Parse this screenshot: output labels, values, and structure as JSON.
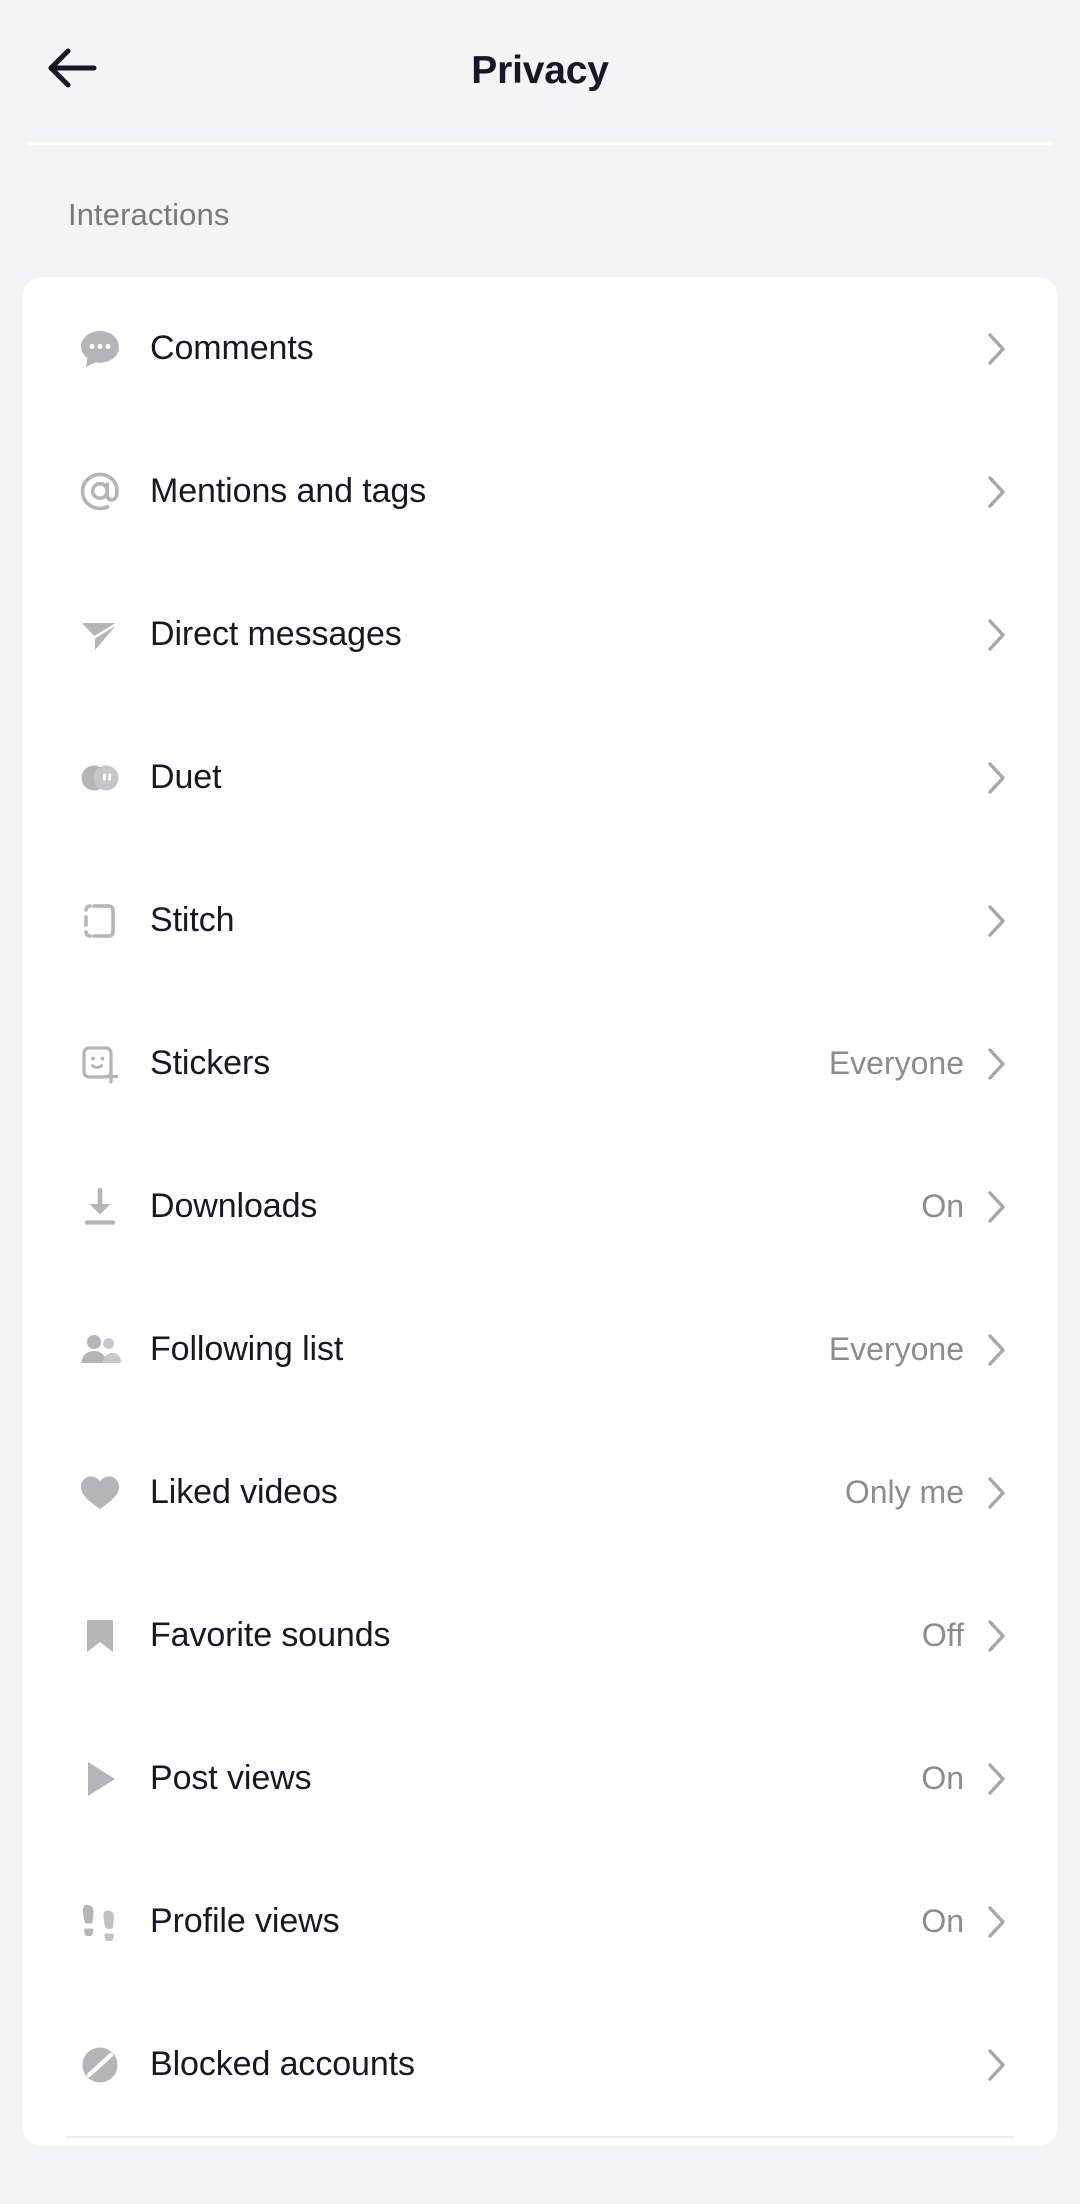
{
  "header": {
    "title": "Privacy",
    "back_icon": "arrow-left-icon"
  },
  "sections": [
    {
      "label": "Interactions",
      "items": [
        {
          "icon": "comment-bubble-icon",
          "label": "Comments",
          "value": "",
          "chevron": "chevron-right-icon"
        },
        {
          "icon": "at-sign-icon",
          "label": "Mentions and tags",
          "value": "",
          "chevron": "chevron-right-icon"
        },
        {
          "icon": "paper-plane-icon",
          "label": "Direct messages",
          "value": "",
          "chevron": "chevron-right-icon"
        },
        {
          "icon": "duet-circles-icon",
          "label": "Duet",
          "value": "",
          "chevron": "chevron-right-icon"
        },
        {
          "icon": "stitch-frame-icon",
          "label": "Stitch",
          "value": "",
          "chevron": "chevron-right-icon"
        },
        {
          "icon": "sticker-smiley-icon",
          "label": "Stickers",
          "value": "Everyone",
          "chevron": "chevron-right-icon"
        },
        {
          "icon": "download-icon",
          "label": "Downloads",
          "value": "On",
          "chevron": "chevron-right-icon"
        },
        {
          "icon": "people-icon",
          "label": "Following list",
          "value": "Everyone",
          "chevron": "chevron-right-icon"
        },
        {
          "icon": "heart-icon",
          "label": "Liked videos",
          "value": "Only me",
          "chevron": "chevron-right-icon"
        },
        {
          "icon": "bookmark-icon",
          "label": "Favorite sounds",
          "value": "Off",
          "chevron": "chevron-right-icon"
        },
        {
          "icon": "play-triangle-icon",
          "label": "Post views",
          "value": "On",
          "chevron": "chevron-right-icon"
        },
        {
          "icon": "footprints-icon",
          "label": "Profile views",
          "value": "On",
          "chevron": "chevron-right-icon"
        },
        {
          "icon": "block-slash-icon",
          "label": "Blocked accounts",
          "value": "",
          "chevron": "chevron-right-icon"
        }
      ]
    }
  ],
  "colors": {
    "background": "#f3f4f5",
    "card": "#ffffff",
    "text_primary": "#161823",
    "text_secondary": "#8b8b90",
    "icon_gray": "#b4b4b9",
    "chevron_gray": "#a6a6ab"
  }
}
